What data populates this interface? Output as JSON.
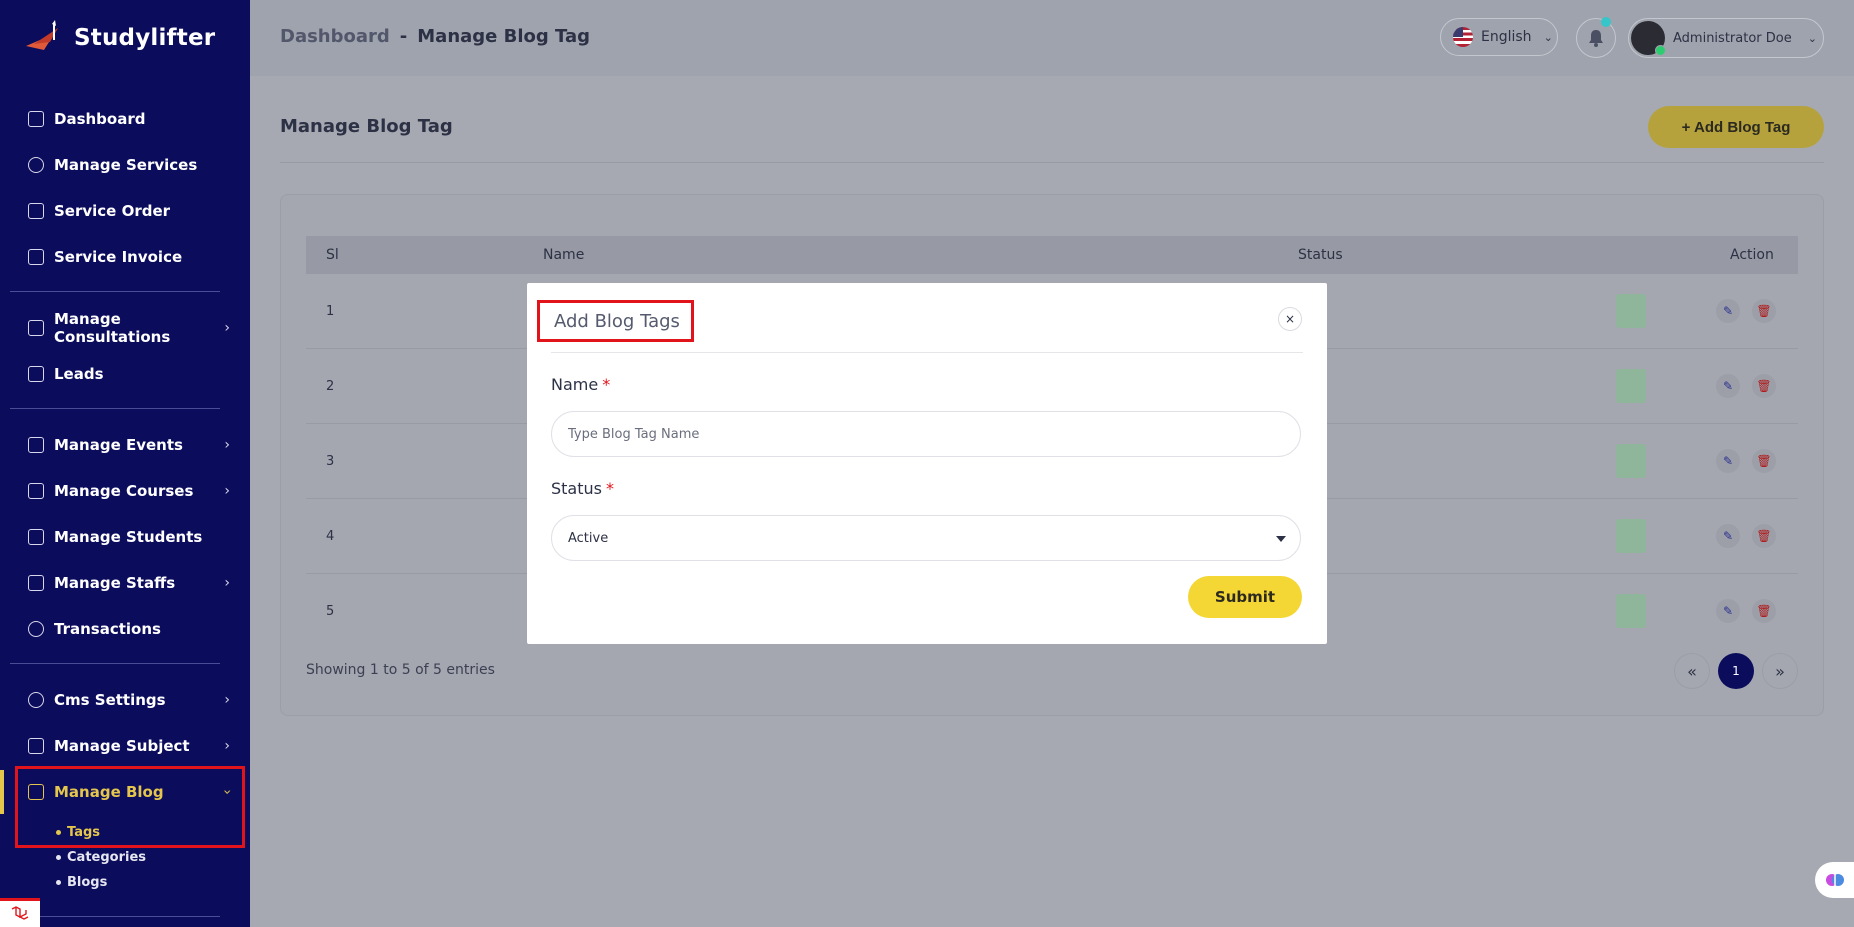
{
  "brand": {
    "name": "Studylifter"
  },
  "sidebar": {
    "items": [
      {
        "label": "Dashboard",
        "icon": "grid-icon"
      },
      {
        "label": "Manage Services",
        "icon": "gear-icon"
      },
      {
        "label": "Service Order",
        "icon": "list-icon"
      },
      {
        "label": "Service Invoice",
        "icon": "invoice-icon"
      },
      {
        "label": "Manage Consultations",
        "icon": "user-card-icon",
        "expandable": true
      },
      {
        "label": "Leads",
        "icon": "lead-icon"
      },
      {
        "label": "Manage Events",
        "icon": "calendar-icon",
        "expandable": true
      },
      {
        "label": "Manage Courses",
        "icon": "course-icon",
        "expandable": true
      },
      {
        "label": "Manage Students",
        "icon": "students-icon"
      },
      {
        "label": "Manage Staffs",
        "icon": "staff-icon",
        "expandable": true
      },
      {
        "label": "Transactions",
        "icon": "transactions-icon"
      },
      {
        "label": "Cms Settings",
        "icon": "settings-icon",
        "expandable": true
      },
      {
        "label": "Manage Subject",
        "icon": "book-icon",
        "expandable": true
      },
      {
        "label": "Manage Blog",
        "icon": "blog-icon",
        "expandable": true,
        "active": true
      }
    ],
    "blog_subitems": [
      {
        "label": "Tags",
        "active": true
      },
      {
        "label": "Categories"
      },
      {
        "label": "Blogs"
      }
    ]
  },
  "topbar": {
    "breadcrumb_root": "Dashboard",
    "breadcrumb_sep": "-",
    "breadcrumb_current": "Manage Blog Tag",
    "language": "English",
    "user_name": "Administrator Doe"
  },
  "page": {
    "title": "Manage Blog Tag",
    "add_button": "+ Add Blog Tag"
  },
  "table": {
    "columns": [
      "Sl",
      "Name",
      "Status",
      "Action"
    ],
    "rows": [
      {
        "sl": "1"
      },
      {
        "sl": "2"
      },
      {
        "sl": "3"
      },
      {
        "sl": "4"
      },
      {
        "sl": "5"
      }
    ],
    "showing": "Showing 1 to 5 of 5 entries",
    "pagination": {
      "prev": "«",
      "current": "1",
      "next": "»"
    }
  },
  "modal": {
    "title": "Add Blog Tags",
    "close": "×",
    "name_label": "Name",
    "required_mark": "*",
    "name_placeholder": "Type Blog Tag Name",
    "status_label": "Status",
    "status_value": "Active",
    "submit": "Submit"
  },
  "colors": {
    "sidebar_bg": "#0b0c5c",
    "accent_yellow": "#f4d634",
    "active_gold": "#e4c64d",
    "highlight_red": "#e0141a"
  }
}
